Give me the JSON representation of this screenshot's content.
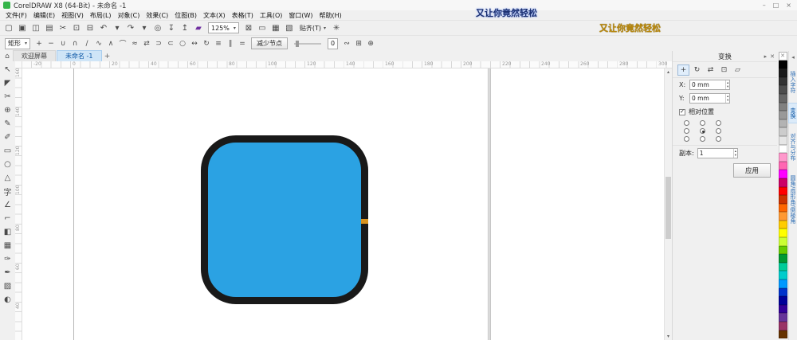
{
  "window": {
    "title": "CorelDRAW X8 (64-Bit) - 未命名 -1",
    "controls": {
      "min": "–",
      "max": "□",
      "close": "×"
    }
  },
  "watermarks": {
    "top": "又让你竟然轻松",
    "gold": "又让你竟然轻松"
  },
  "menu": {
    "items": [
      "文件(F)",
      "编辑(E)",
      "视图(V)",
      "布局(L)",
      "对象(C)",
      "效果(C)",
      "位图(B)",
      "文本(X)",
      "表格(T)",
      "工具(O)",
      "窗口(W)",
      "帮助(H)"
    ]
  },
  "toolbar": {
    "icons": [
      {
        "n": "new-document-icon",
        "g": "▢"
      },
      {
        "n": "open-icon",
        "g": "▣"
      },
      {
        "n": "save-icon",
        "g": "◫"
      },
      {
        "n": "print-icon",
        "g": "▤"
      },
      {
        "n": "cut-icon",
        "g": "✂"
      },
      {
        "n": "copy-icon",
        "g": "⊡"
      },
      {
        "n": "paste-icon",
        "g": "⊟"
      },
      {
        "n": "undo-icon",
        "g": "↶"
      },
      {
        "n": "undo-dropdown-icon",
        "g": "▾"
      },
      {
        "n": "redo-icon",
        "g": "↷"
      },
      {
        "n": "redo-dropdown-icon",
        "g": "▾"
      },
      {
        "n": "search-content-icon",
        "g": "◎"
      },
      {
        "n": "import-icon",
        "g": "↧"
      },
      {
        "n": "export-icon",
        "g": "↥"
      },
      {
        "n": "publish-pdf-icon",
        "g": "▰",
        "c": "#7030a0"
      }
    ],
    "zoom": {
      "value": "125%",
      "caret": "▾"
    },
    "view_icons": [
      {
        "n": "fullscreen-preview-icon",
        "g": "⊠"
      },
      {
        "n": "show-rulers-icon",
        "g": "▭"
      },
      {
        "n": "show-grid-icon",
        "g": "▦"
      },
      {
        "n": "show-guidelines-icon",
        "g": "▧"
      }
    ],
    "snap": {
      "label": "贴齐(T)",
      "caret": "▾"
    },
    "options": {
      "n": "options-gear-icon",
      "g": "✳"
    }
  },
  "propbar": {
    "mode": {
      "value": "矩形",
      "caret": "▾"
    },
    "node_icons": [
      {
        "n": "add-node-icon",
        "g": "+"
      },
      {
        "n": "delete-node-icon",
        "g": "−"
      },
      {
        "n": "join-nodes-icon",
        "g": "∪"
      },
      {
        "n": "break-curve-icon",
        "g": "∩"
      },
      {
        "n": "convert-to-line-icon",
        "g": "∕"
      },
      {
        "n": "convert-to-curve-icon",
        "g": "∿"
      },
      {
        "n": "cusp-node-icon",
        "g": "∧"
      },
      {
        "n": "smooth-node-icon",
        "g": "⌒"
      },
      {
        "n": "symmetrical-node-icon",
        "g": "≈"
      },
      {
        "n": "reverse-direction-icon",
        "g": "⇄"
      },
      {
        "n": "extend-curve-icon",
        "g": "⊃"
      },
      {
        "n": "extract-subpath-icon",
        "g": "⊂"
      },
      {
        "n": "close-curve-icon",
        "g": "○"
      },
      {
        "n": "stretch-nodes-icon",
        "g": "↔"
      },
      {
        "n": "rotate-nodes-icon",
        "g": "↻"
      },
      {
        "n": "align-nodes-icon",
        "g": "≡"
      },
      {
        "n": "reflect-horizontal-icon",
        "g": "∥"
      },
      {
        "n": "reflect-vertical-icon",
        "g": "="
      }
    ],
    "reduce_nodes_label": "减少节点",
    "smoothness_value": "0",
    "right_icons": [
      {
        "n": "elastic-mode-icon",
        "g": "∾"
      },
      {
        "n": "select-all-nodes-icon",
        "g": "⊞"
      },
      {
        "n": "box-select-icon",
        "g": "⊕"
      }
    ]
  },
  "tabbar": {
    "home_glyph": "⌂",
    "tabs": [
      {
        "label": "欢迎屏幕"
      },
      {
        "label": "未命名 -1"
      }
    ],
    "new_tab_glyph": "+"
  },
  "rulers": {
    "h_labels": [
      "-20",
      "0",
      "20",
      "40",
      "60",
      "80",
      "100",
      "120",
      "140",
      "160",
      "180",
      "200",
      "220",
      "240",
      "260",
      "280",
      "300"
    ],
    "v_labels": [
      "160",
      "140",
      "120",
      "100",
      "80",
      "60",
      "40"
    ]
  },
  "toolbox": {
    "tools": [
      {
        "n": "pick-tool-icon",
        "g": "↖"
      },
      {
        "n": "shape-tool-icon",
        "g": "◤"
      },
      {
        "n": "crop-tool-icon",
        "g": "✂"
      },
      {
        "n": "zoom-tool-icon",
        "g": "⊕"
      },
      {
        "n": "freehand-tool-icon",
        "g": "✎"
      },
      {
        "n": "artistic-media-tool-icon",
        "g": "✐"
      },
      {
        "n": "rectangle-tool-icon",
        "g": "▭"
      },
      {
        "n": "ellipse-tool-icon",
        "g": "○"
      },
      {
        "n": "polygon-tool-icon",
        "g": "△"
      },
      {
        "n": "text-tool-icon",
        "g": "字"
      },
      {
        "n": "parallel-dimension-tool-icon",
        "g": "∠"
      },
      {
        "n": "connector-tool-icon",
        "g": "⌐"
      },
      {
        "n": "interactive-fill-tool-icon",
        "g": "◧"
      },
      {
        "n": "mesh-fill-tool-icon",
        "g": "▦"
      },
      {
        "n": "color-eyedropper-tool-icon",
        "g": "✑"
      },
      {
        "n": "outline-pen-tool-icon",
        "g": "✒"
      },
      {
        "n": "fill-tool-icon",
        "g": "▨"
      },
      {
        "n": "transparency-tool-icon",
        "g": "◐"
      }
    ]
  },
  "canvas": {
    "shape": {
      "fill": "#2ba2e3",
      "outline": "#191919",
      "node_color": "#d9931f"
    }
  },
  "scrollbar": {
    "up": "▴",
    "down": "▾"
  },
  "docker": {
    "title": "变换",
    "flyout": "▸",
    "close": "✕",
    "modes": [
      {
        "n": "position-mode-icon",
        "g": "+",
        "active": true
      },
      {
        "n": "rotate-mode-icon",
        "g": "↻",
        "active": false
      },
      {
        "n": "scale-mirror-mode-icon",
        "g": "⇄",
        "active": false
      },
      {
        "n": "size-mode-icon",
        "g": "⊡",
        "active": false
      },
      {
        "n": "skew-mode-icon",
        "g": "▱",
        "active": false
      }
    ],
    "x_label": "X:",
    "x_value": "0 mm",
    "y_label": "Y:",
    "y_value": "0 mm",
    "spin_up": "▴",
    "spin_down": "▾",
    "relative_check": "✓",
    "relative_label": "相对位置",
    "anchors": [
      {
        "checked": false
      },
      {
        "checked": false
      },
      {
        "checked": false
      },
      {
        "checked": false
      },
      {
        "checked": true
      },
      {
        "checked": false
      },
      {
        "checked": false
      },
      {
        "checked": false
      },
      {
        "checked": false
      }
    ],
    "copies_label": "副本:",
    "copies_value": "1",
    "apply_label": "应用"
  },
  "palette": {
    "none_glyph": "✕",
    "colors": [
      "#000000",
      "#1a1a1a",
      "#333333",
      "#4d4d4d",
      "#666666",
      "#808080",
      "#999999",
      "#b3b3b3",
      "#cccccc",
      "#e6e6e6",
      "#ffffff",
      "#ff99cc",
      "#ff66b2",
      "#ff00ff",
      "#cc0066",
      "#ff0000",
      "#cc3300",
      "#ff6600",
      "#ff9933",
      "#ffcc00",
      "#ffff00",
      "#ccff33",
      "#66cc00",
      "#009933",
      "#00cc99",
      "#00cccc",
      "#0099ff",
      "#0033cc",
      "#000099",
      "#330099",
      "#663399",
      "#993366",
      "#663300"
    ]
  },
  "side_tabs": {
    "collapse_glyph": "◂",
    "items": [
      {
        "label": "插入字符",
        "active": false
      },
      {
        "label": "变换",
        "active": true
      },
      {
        "label": "对齐与分布",
        "active": false
      },
      {
        "label": "圆角/扇形角/倒棱角",
        "active": false
      }
    ]
  }
}
